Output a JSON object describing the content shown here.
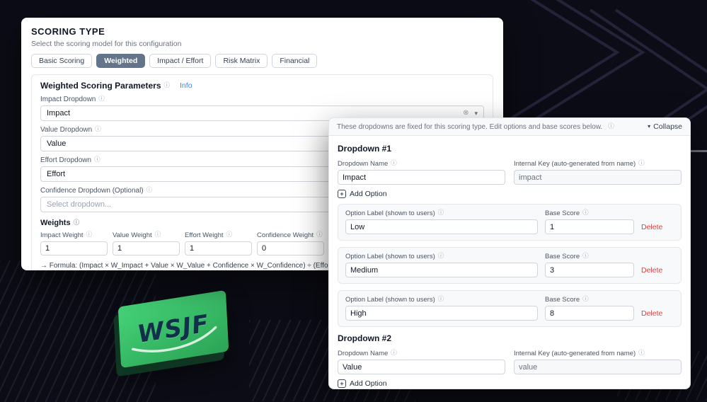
{
  "colors": {
    "page_background": "#0c0c16",
    "accent_blue": "#3b82f6",
    "selected_tab": "#64748b",
    "delete_red": "#d64545",
    "card_green": "#38c06a"
  },
  "icons": {
    "info": "ⓘ",
    "clear": "⊗",
    "chevron_down": "▾",
    "plus": "+"
  },
  "background": {
    "wsjf_label": "WSJF"
  },
  "scoring_panel": {
    "title": "SCORING TYPE",
    "subtitle": "Select the scoring model for this configuration",
    "tabs": [
      {
        "label": "Basic Scoring",
        "selected": false
      },
      {
        "label": "Weighted",
        "selected": true
      },
      {
        "label": "Impact / Effort",
        "selected": false
      },
      {
        "label": "Risk Matrix",
        "selected": false
      },
      {
        "label": "Financial",
        "selected": false
      }
    ],
    "section": {
      "title": "Weighted Scoring Parameters",
      "info_link": "Info"
    },
    "fields": [
      {
        "label": "Impact Dropdown",
        "value": "Impact"
      },
      {
        "label": "Value Dropdown",
        "value": "Value"
      },
      {
        "label": "Effort Dropdown",
        "value": "Effort"
      },
      {
        "label": "Confidence Dropdown (Optional)",
        "placeholder": "Select dropdown..."
      }
    ],
    "weights": {
      "title": "Weights",
      "items": [
        {
          "label": "Impact Weight",
          "value": "1"
        },
        {
          "label": "Value Weight",
          "value": "1"
        },
        {
          "label": "Effort Weight",
          "value": "1"
        },
        {
          "label": "Confidence Weight",
          "value": "0"
        }
      ],
      "formula": "→ Formula: (Impact × W_Impact + Value × W_Value + Confidence × W_Confidence) ÷ (Effort × W_Effort)"
    }
  },
  "editor_panel": {
    "notice": "These dropdowns are fixed for this scoring type. Edit options and base scores below.",
    "collapse_label": "Collapse",
    "labels": {
      "dropdown_name": "Dropdown Name",
      "internal_key": "Internal Key (auto-generated from name)",
      "option_label": "Option Label (shown to users)",
      "base_score": "Base Score",
      "delete": "Delete",
      "add_option": "Add Option"
    },
    "dropdowns": [
      {
        "title": "Dropdown #1",
        "name": "Impact",
        "key": "impact",
        "options": [
          {
            "label": "Low",
            "score": "1"
          },
          {
            "label": "Medium",
            "score": "3"
          },
          {
            "label": "High",
            "score": "8"
          }
        ]
      },
      {
        "title": "Dropdown #2",
        "name": "Value",
        "key": "value",
        "options": []
      }
    ]
  }
}
